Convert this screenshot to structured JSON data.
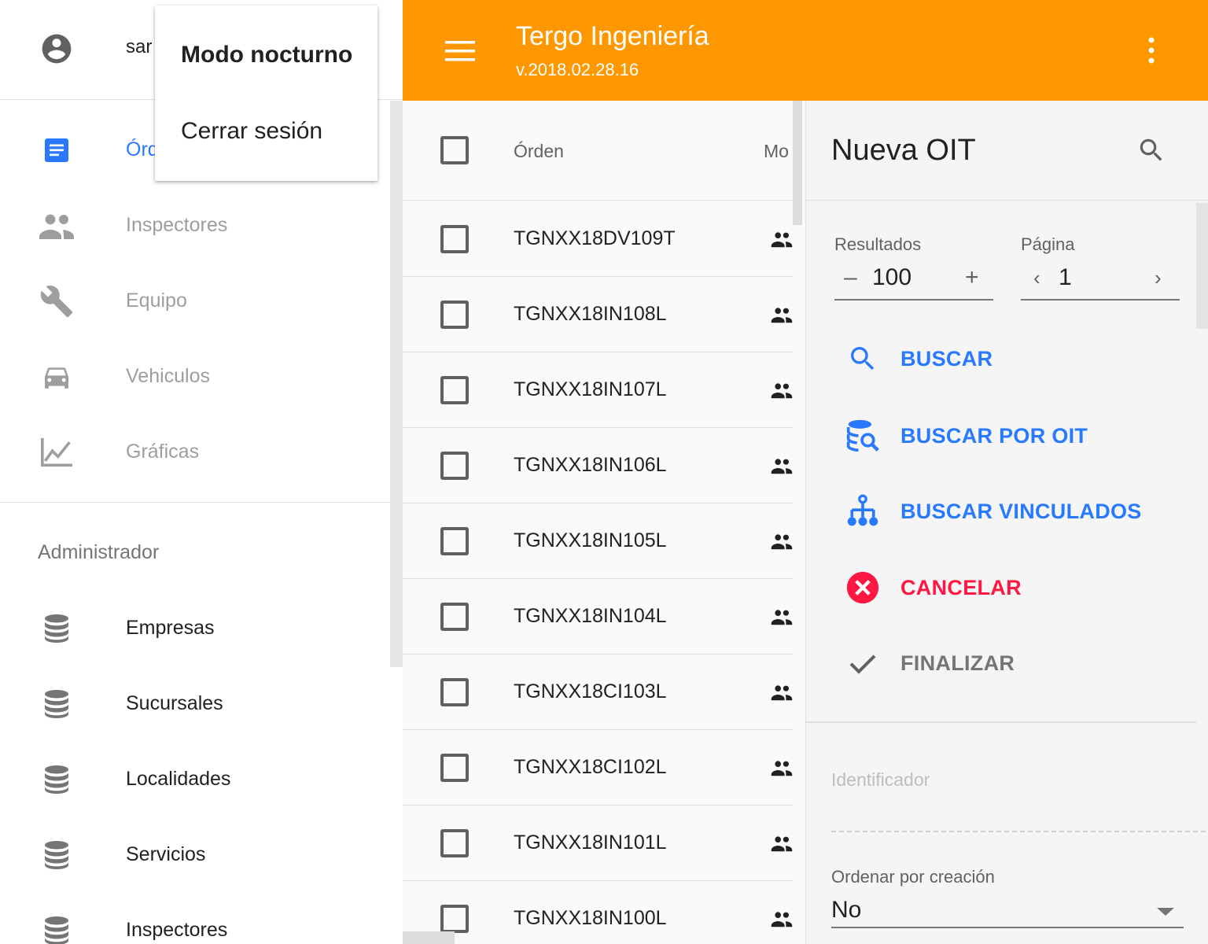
{
  "drawer": {
    "user_name": "sar",
    "nav": [
      {
        "label": "Órdenes",
        "icon": "document-icon"
      },
      {
        "label": "Inspectores",
        "icon": "people-icon"
      },
      {
        "label": "Equipo",
        "icon": "wrench-icon"
      },
      {
        "label": "Vehiculos",
        "icon": "car-icon"
      },
      {
        "label": "Gráficas",
        "icon": "line-chart-icon"
      }
    ],
    "admin_section": "Administrador",
    "admin": [
      {
        "label": "Empresas",
        "icon": "database-icon"
      },
      {
        "label": "Sucursales",
        "icon": "database-icon"
      },
      {
        "label": "Localidades",
        "icon": "database-icon"
      },
      {
        "label": "Servicios",
        "icon": "database-icon"
      },
      {
        "label": "Inspectores",
        "icon": "database-icon"
      }
    ]
  },
  "user_menu": {
    "items": [
      "Modo nocturno",
      "Cerrar sesión"
    ]
  },
  "appbar": {
    "title": "Tergo Ingeniería",
    "version": "v.2018.02.28.16",
    "color": "#ff9800"
  },
  "table": {
    "headers": [
      "Órden",
      "Mo"
    ],
    "rows": [
      "TGNXX18DV109T",
      "TGNXX18IN108L",
      "TGNXX18IN107L",
      "TGNXX18IN106L",
      "TGNXX18IN105L",
      "TGNXX18IN104L",
      "TGNXX18CI103L",
      "TGNXX18CI102L",
      "TGNXX18IN101L",
      "TGNXX18IN100L"
    ]
  },
  "panel": {
    "title": "Nueva OIT",
    "results_label": "Resultados",
    "results_value": "100",
    "page_label": "Página",
    "page_value": "1",
    "actions": {
      "search": "BUSCAR",
      "search_oit": "BUSCAR POR OIT",
      "search_linked": "BUSCAR VINCULADOS",
      "cancel": "CANCELAR",
      "finish": "FINALIZAR"
    },
    "id_placeholder": "Identificador",
    "sort_label": "Ordenar por creación",
    "sort_value": "No"
  },
  "colors": {
    "accent_blue": "#2979ff",
    "danger": "#ff1744",
    "appbar": "#ff9800"
  }
}
